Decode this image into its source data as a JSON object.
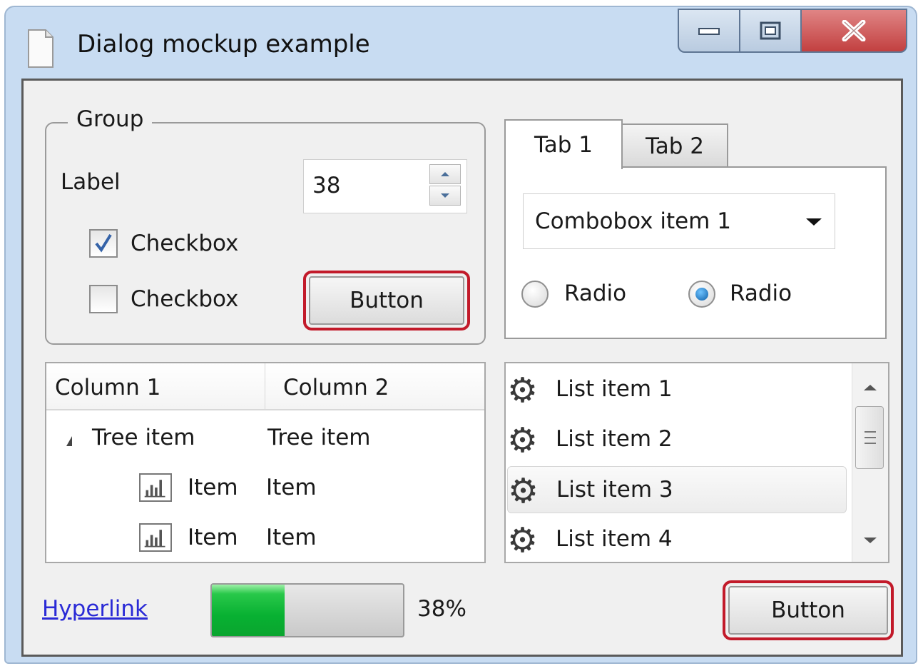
{
  "window": {
    "title": "Dialog mockup example",
    "controls": {
      "minimize": "minimize",
      "maximize": "maximize",
      "close": "close"
    }
  },
  "group": {
    "legend": "Group",
    "label": "Label",
    "spinner_value": "38",
    "checkbox1": {
      "label": "Checkbox",
      "checked": true
    },
    "checkbox2": {
      "label": "Checkbox",
      "checked": false
    },
    "button_label": "Button"
  },
  "tabs": {
    "items": [
      {
        "label": "Tab 1",
        "active": true
      },
      {
        "label": "Tab 2",
        "active": false
      }
    ],
    "combobox_value": "Combobox item 1",
    "radio1": {
      "label": "Radio",
      "selected": false
    },
    "radio2": {
      "label": "Radio",
      "selected": true
    }
  },
  "tree": {
    "columns": [
      "Column 1",
      "Column 2"
    ],
    "rows": [
      {
        "col1": "Tree item",
        "col2": "Tree item",
        "expanded": true
      },
      {
        "col1": "Item",
        "col2": "Item"
      },
      {
        "col1": "Item",
        "col2": "Item"
      }
    ]
  },
  "list": {
    "items": [
      "List item 1",
      "List item 2",
      "List item 3",
      "List item 4"
    ],
    "selected_index": 2,
    "icon": "gear-icon"
  },
  "footer": {
    "hyperlink": "Hyperlink",
    "progress_percent": 38,
    "progress_text": "38%",
    "button_label": "Button"
  },
  "colors": {
    "highlight_outline": "#c21a2a",
    "link": "#2a2ad6",
    "progress_fill": "#08b132",
    "close_button": "#c24040"
  }
}
